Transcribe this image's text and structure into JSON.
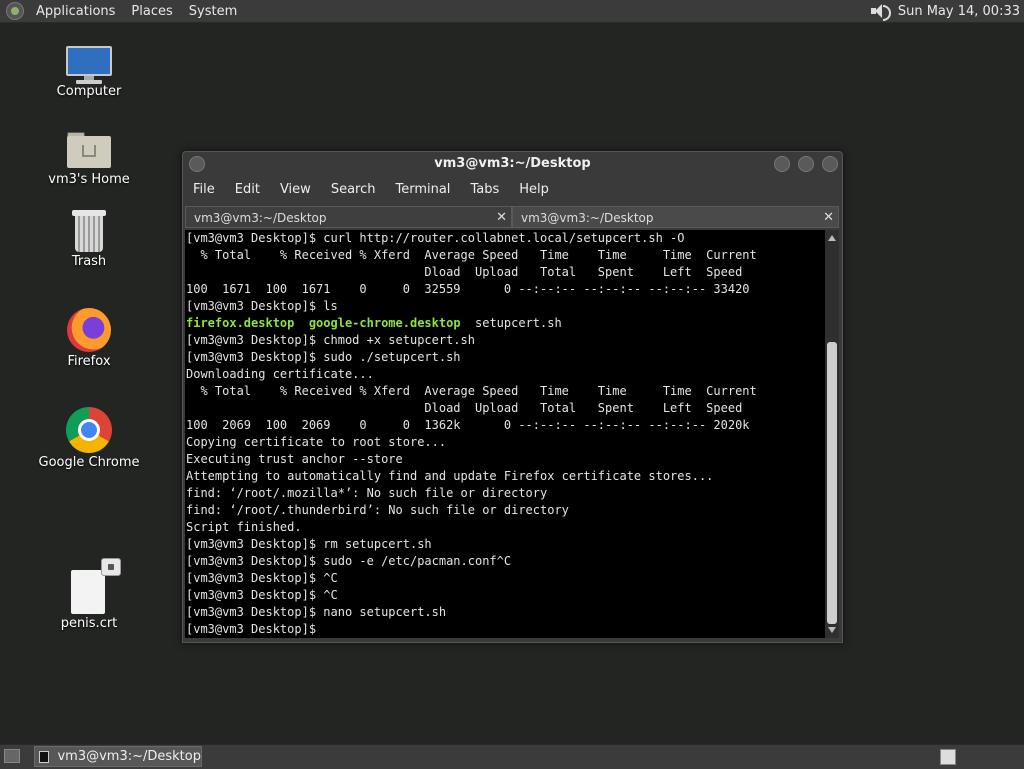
{
  "top_panel": {
    "menus": [
      "Applications",
      "Places",
      "System"
    ],
    "clock": "Sun May 14, 00:33"
  },
  "desktop_icons": [
    {
      "label": "Computer",
      "icon": "computer-icon"
    },
    {
      "label": "vm3's Home",
      "icon": "home-folder-icon"
    },
    {
      "label": "Trash",
      "icon": "trash-icon"
    },
    {
      "label": "Firefox",
      "icon": "firefox-icon"
    },
    {
      "label": "Google Chrome",
      "icon": "chrome-icon"
    },
    {
      "label": "penis.crt",
      "icon": "certificate-file-icon"
    }
  ],
  "window": {
    "title": "vm3@vm3:~/Desktop",
    "menus": [
      "File",
      "Edit",
      "View",
      "Search",
      "Terminal",
      "Tabs",
      "Help"
    ],
    "tabs": [
      {
        "label": "vm3@vm3:~/Desktop",
        "close": "✕"
      },
      {
        "label": "vm3@vm3:~/Desktop",
        "close": "✕"
      }
    ]
  },
  "terminal": {
    "lines": [
      "[vm3@vm3 Desktop]$ curl http://router.collabnet.local/setupcert.sh -O",
      "  % Total    % Received % Xferd  Average Speed   Time    Time     Time  Current",
      "                                 Dload  Upload   Total   Spent    Left  Speed",
      "100  1671  100  1671    0     0  32559      0 --:--:-- --:--:-- --:--:-- 33420",
      "[vm3@vm3 Desktop]$ ls",
      "",
      "[vm3@vm3 Desktop]$ chmod +x setupcert.sh",
      "[vm3@vm3 Desktop]$ sudo ./setupcert.sh",
      "Downloading certificate...",
      "  % Total    % Received % Xferd  Average Speed   Time    Time     Time  Current",
      "                                 Dload  Upload   Total   Spent    Left  Speed",
      "100  2069  100  2069    0     0  1362k      0 --:--:-- --:--:-- --:--:-- 2020k",
      "Copying certificate to root store...",
      "Executing trust anchor --store",
      "Attempting to automatically find and update Firefox certificate stores...",
      "find: ‘/root/.mozilla*’: No such file or directory",
      "find: ‘/root/.thunderbird’: No such file or directory",
      "Script finished.",
      "[vm3@vm3 Desktop]$ rm setupcert.sh",
      "[vm3@vm3 Desktop]$ sudo -e /etc/pacman.conf^C",
      "[vm3@vm3 Desktop]$ ^C",
      "[vm3@vm3 Desktop]$ ^C",
      "[vm3@vm3 Desktop]$ nano setupcert.sh",
      "[vm3@vm3 Desktop]$ "
    ],
    "ls_output": {
      "green1": "firefox.desktop",
      "green2": "google-chrome.desktop",
      "plain": "setupcert.sh"
    }
  },
  "bottom_panel": {
    "task": "vm3@vm3:~/Desktop"
  }
}
